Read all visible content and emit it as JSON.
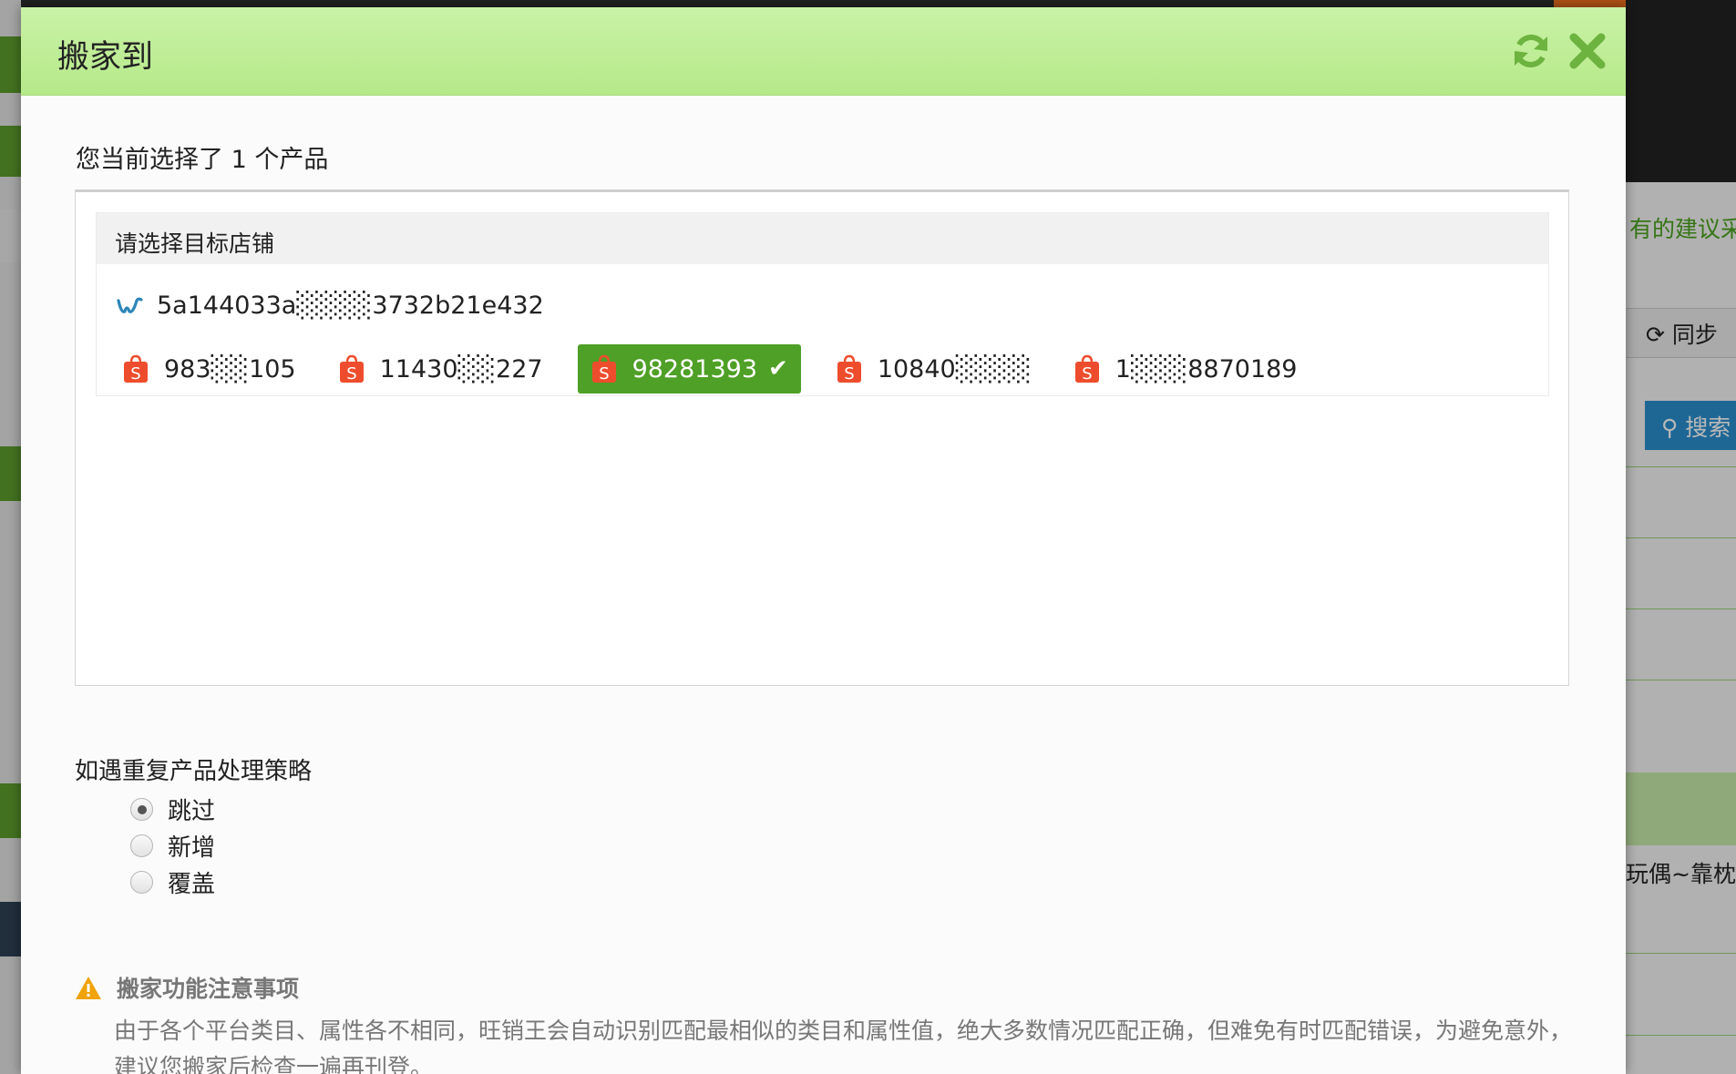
{
  "modal": {
    "title": "搬家到",
    "refresh_icon": "refresh-icon",
    "close_icon": "close-icon",
    "header_color": "#c3ef9c"
  },
  "selection": {
    "text": "您当前选择了 1 个产品"
  },
  "store_picker": {
    "heading": "请选择目标店铺",
    "wish_store": {
      "icon": "wish-logo-icon",
      "name": "5a144033a░░░░3732b21e432"
    },
    "shopee_stores": [
      {
        "icon": "shopee-bag-icon",
        "name": "983░░105",
        "selected": false
      },
      {
        "icon": "shopee-bag-icon",
        "name": "11430░░227",
        "selected": false
      },
      {
        "icon": "shopee-bag-icon",
        "name": "98281393",
        "selected": true
      },
      {
        "icon": "shopee-bag-icon",
        "name": "10840░░░░",
        "selected": false
      },
      {
        "icon": "shopee-bag-icon",
        "name": "1░░░8870189",
        "selected": false
      }
    ],
    "selected_color": "#4fa026",
    "shopee_color": "#ee4d2d"
  },
  "duplicate_strategy": {
    "label": "如遇重复产品处理策略",
    "options": [
      {
        "label": "跳过",
        "checked": true
      },
      {
        "label": "新增",
        "checked": false
      },
      {
        "label": "覆盖",
        "checked": false
      }
    ]
  },
  "notice": {
    "icon": "warning-icon",
    "title": "搬家功能注意事项",
    "body": "由于各个平台类目、属性各不相同，旺销王会自动识别匹配最相似的类目和属性值，绝大多数情况匹配正确，但难免有时匹配错误，为避免意外，建议您搬家后检查一遍再刊登。"
  },
  "background": {
    "right_text": "有的建议采",
    "sync_label": "同步",
    "search_label": "搜索",
    "row_text": "玩偶~靠枕~"
  }
}
